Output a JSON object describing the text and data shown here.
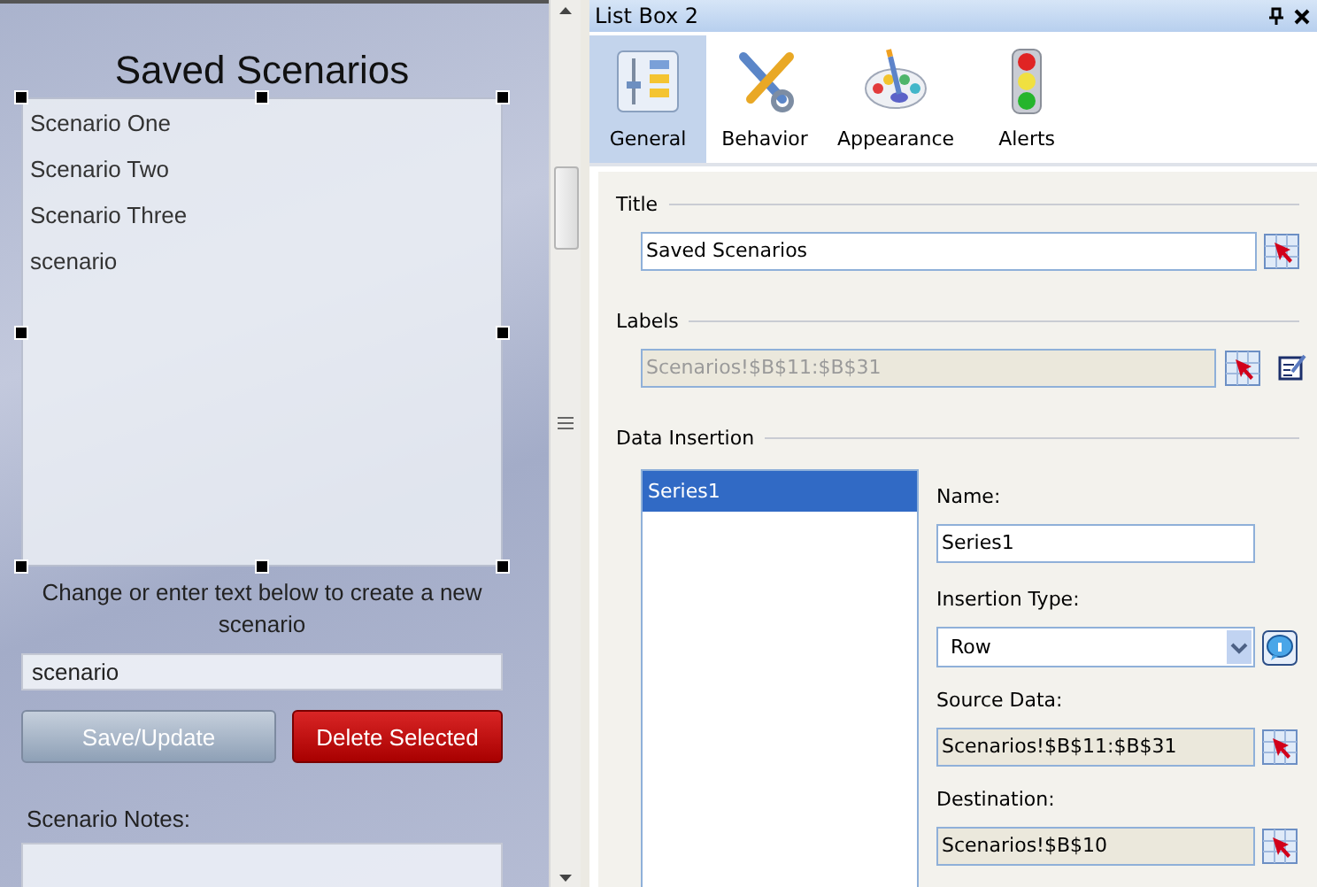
{
  "canvas": {
    "title": "Saved Scenarios",
    "list_items": [
      {
        "label": "Scenario One",
        "selected": false
      },
      {
        "label": "Scenario Two",
        "selected": false
      },
      {
        "label": "Scenario Three",
        "selected": false
      },
      {
        "label": "scenario",
        "selected": false
      }
    ],
    "instruction": "Change or enter text below to create a new scenario",
    "name_field": {
      "value": "scenario"
    },
    "buttons": [
      {
        "label": "Save/Update",
        "kind": "secondary"
      },
      {
        "label": "Delete Selected",
        "kind": "danger"
      }
    ],
    "notes_label": "Scenario Notes:"
  },
  "panel": {
    "title": "List Box 2",
    "tabs": [
      {
        "label": "General",
        "selected": true
      },
      {
        "label": "Behavior",
        "selected": false
      },
      {
        "label": "Appearance",
        "selected": false
      },
      {
        "label": "Alerts",
        "selected": false
      }
    ],
    "title_section": {
      "heading": "Title",
      "field": {
        "value": "Saved Scenarios",
        "disabled": false
      }
    },
    "labels_section": {
      "heading": "Labels",
      "field": {
        "value": "Scenarios!$B$11:$B$31",
        "disabled": true
      }
    },
    "data_insertion": {
      "heading": "Data Insertion",
      "series": [
        {
          "label": "Series1",
          "selected": true
        }
      ],
      "name": {
        "label": "Name:",
        "value": "Series1"
      },
      "insertion_type": {
        "label": "Insertion Type:",
        "value": "Row"
      },
      "source_data": {
        "label": "Source Data:",
        "value": "Scenarios!$B$11:$B$31"
      },
      "destination": {
        "label": "Destination:",
        "value": "Scenarios!$B$10"
      }
    }
  }
}
